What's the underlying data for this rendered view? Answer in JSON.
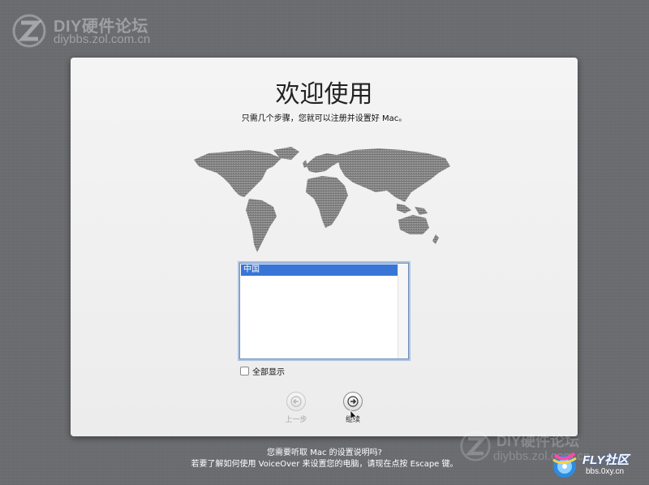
{
  "watermark": {
    "top_title": "DIY硬件论坛",
    "top_url": "diybbs.zol.com.cn",
    "bottom_title": "DIY硬件论坛",
    "bottom_url": "diybbs.zol.com.cn"
  },
  "panel": {
    "title": "欢迎使用",
    "subtitle": "只需几个步骤，您就可以注册并设置好 Mac。"
  },
  "country_list": {
    "items": [
      "中国"
    ],
    "selected": "中国"
  },
  "show_all_checkbox": {
    "label": "全部显示",
    "checked": false
  },
  "navigation": {
    "back_label": "上一步",
    "next_label": "继续",
    "back_enabled": false
  },
  "footer": {
    "line1": "您需要听取 Mac 的设置说明吗?",
    "line2": "若要了解如何使用 VoiceOver 来设置您的电脑，请现在点按 Escape 键。"
  },
  "fly_logo": {
    "title": "FLY社区",
    "url": "bbs.0xy.cn"
  },
  "colors": {
    "selection": "#3875d7",
    "panel_bg": "#ececec",
    "desktop_bg": "#6b6c70"
  }
}
